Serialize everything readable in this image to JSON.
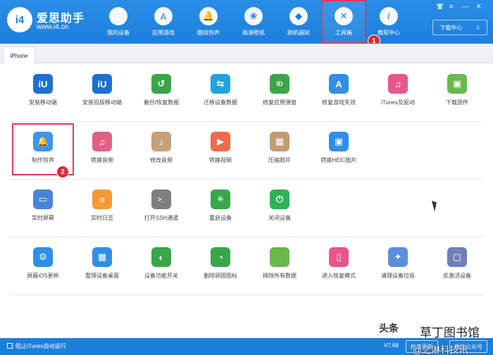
{
  "app": {
    "logo_text": "i4",
    "name": "爱思助手",
    "site": "www.i4.cn"
  },
  "nav": [
    {
      "label": "我的设备",
      "icon": "apple-icon",
      "glyph": ""
    },
    {
      "label": "应用游戏",
      "icon": "app-store-icon",
      "glyph": "A"
    },
    {
      "label": "酷炫铃声",
      "icon": "bell-icon",
      "glyph": "🔔"
    },
    {
      "label": "高清壁纸",
      "icon": "flower-icon",
      "glyph": "❀"
    },
    {
      "label": "刷机越狱",
      "icon": "dropbox-icon",
      "glyph": "◆"
    },
    {
      "label": "工具箱",
      "icon": "tools-icon",
      "glyph": "✕"
    },
    {
      "label": "教程中心",
      "icon": "info-icon",
      "glyph": "i"
    }
  ],
  "download_center": "下载中心",
  "markers": {
    "first": "1",
    "second": "2"
  },
  "tab": "iPhone",
  "rows": [
    [
      {
        "label": "安装移动端",
        "icon": "i4-icon",
        "color": "#1e6fd2",
        "glyph": "iU"
      },
      {
        "label": "安装旧版移动端",
        "icon": "i4-old-icon",
        "color": "#1e6fd2",
        "glyph": "iU"
      },
      {
        "label": "备份/恢复数据",
        "icon": "backup-icon",
        "color": "#3aa64a",
        "glyph": "↺"
      },
      {
        "label": "迁移设备数据",
        "icon": "migrate-icon",
        "color": "#22a3dd",
        "glyph": "⇆"
      },
      {
        "label": "修复应用弹窗",
        "icon": "appleid-icon",
        "color": "#3aa64a",
        "glyph": "ID"
      },
      {
        "label": "修复游戏失效",
        "icon": "appstore-fix-icon",
        "color": "#2f8ee6",
        "glyph": "A"
      },
      {
        "label": "iTunes及驱动",
        "icon": "itunes-icon",
        "color": "#e8568a",
        "glyph": "♫"
      },
      {
        "label": "下载固件",
        "icon": "firmware-icon",
        "color": "#6ab84a",
        "glyph": "▣"
      }
    ],
    [
      {
        "label": "制作铃声",
        "icon": "bell-icon",
        "color": "#3b96ec",
        "glyph": "🔔"
      },
      {
        "label": "转换音频",
        "icon": "audio-convert-icon",
        "color": "#e45f85",
        "glyph": "♫"
      },
      {
        "label": "修改音频",
        "icon": "audio-edit-icon",
        "color": "#c6a27b",
        "glyph": "♪"
      },
      {
        "label": "转换视频",
        "icon": "video-convert-icon",
        "color": "#ee6c4d",
        "glyph": "▶"
      },
      {
        "label": "压缩照片",
        "icon": "photo-compress-icon",
        "color": "#c49c72",
        "glyph": "▦"
      },
      {
        "label": "转换HEIC图片",
        "icon": "heic-icon",
        "color": "#2f8ee6",
        "glyph": "▣"
      }
    ],
    [
      {
        "label": "实时屏幕",
        "icon": "screen-icon",
        "color": "#4a84d9",
        "glyph": "▭"
      },
      {
        "label": "实时日志",
        "icon": "log-icon",
        "color": "#f39a36",
        "glyph": "≡"
      },
      {
        "label": "打开SSH通道",
        "icon": "ssh-icon",
        "color": "#7f7f7f",
        "glyph": ">_"
      },
      {
        "label": "重启设备",
        "icon": "reboot-icon",
        "color": "#3aa64a",
        "glyph": "✳"
      },
      {
        "label": "关闭设备",
        "icon": "power-icon",
        "color": "#2fb358",
        "glyph": "⏻"
      }
    ],
    [
      {
        "label": "屏蔽iOS更新",
        "icon": "gear-icon",
        "color": "#2f8ee6",
        "glyph": "⚙"
      },
      {
        "label": "整理设备桌面",
        "icon": "grid-icon",
        "color": "#2f8ee6",
        "glyph": "▦"
      },
      {
        "label": "设备功能开关",
        "icon": "toggle-icon",
        "color": "#3aa64a",
        "glyph": "◐"
      },
      {
        "label": "删除顽固图标",
        "icon": "pie-icon",
        "color": "#3aa64a",
        "glyph": "◔"
      },
      {
        "label": "抹除所有数据",
        "icon": "apple-erase-icon",
        "color": "#6ab84a",
        "glyph": ""
      },
      {
        "label": "进入恢复模式",
        "icon": "recovery-icon",
        "color": "#e8568a",
        "glyph": "▯"
      },
      {
        "label": "清理设备垃圾",
        "icon": "broom-icon",
        "color": "#5b8de0",
        "glyph": "✦"
      },
      {
        "label": "反激活设备",
        "icon": "deactivate-icon",
        "color": "#6f7fb8",
        "glyph": "▢"
      }
    ]
  ],
  "bottom": {
    "itunes_block": "阻止iTunes自动运行",
    "version": "V7.68",
    "check_update": "检查更新",
    "wechat": "微信公众号"
  },
  "watermark": {
    "line1": "头条",
    "line2": "@之淋科技讯",
    "line3": "草丁图书馆"
  }
}
